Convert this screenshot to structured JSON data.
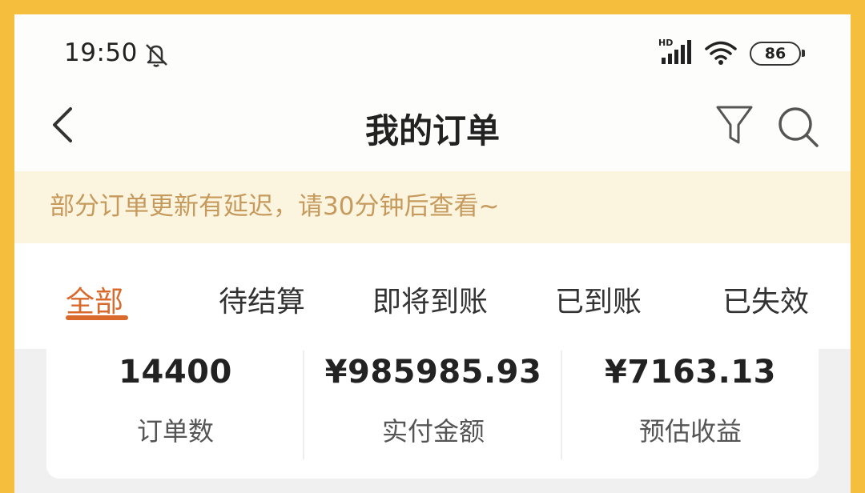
{
  "status_bar": {
    "time": "19:50",
    "network": "HD",
    "battery": "86",
    "icons": [
      "mute-icon",
      "signal-icon",
      "wifi-icon",
      "battery-icon"
    ]
  },
  "header": {
    "title": "我的订单",
    "icons": [
      "back-icon",
      "filter-icon",
      "search-icon"
    ]
  },
  "notice": {
    "text": "部分订单更新有延迟，请30分钟后查看~"
  },
  "tabs": [
    {
      "label": "全部",
      "active": true
    },
    {
      "label": "待结算",
      "active": false
    },
    {
      "label": "即将到账",
      "active": false
    },
    {
      "label": "已到账",
      "active": false
    },
    {
      "label": "已失效",
      "active": false
    }
  ],
  "stats": [
    {
      "value": "14400",
      "label": "订单数"
    },
    {
      "value": "¥985985.93",
      "label": "实付金额"
    },
    {
      "value": "¥7163.13",
      "label": "预估收益"
    }
  ],
  "colors": {
    "frame": "#F5BE3D",
    "accent": "#DA6A2B",
    "notice_bg": "#FBF4DF",
    "notice_text": "#C69A5C"
  }
}
